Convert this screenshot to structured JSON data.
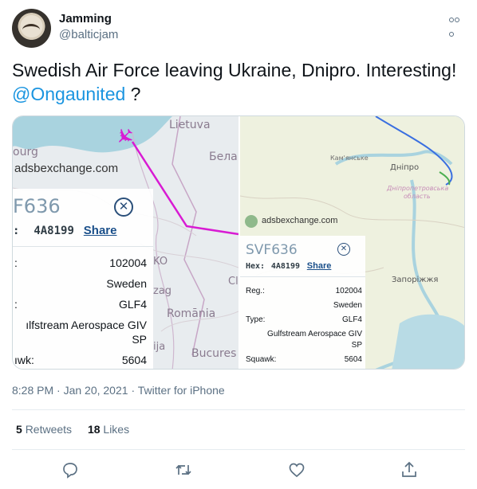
{
  "tweet": {
    "display_name": "Jamming",
    "handle": "@balticjam",
    "text_main": "Swedish Air Force leaving Ukraine, Dnipro. Interesting!",
    "mention": "@Ongaunited",
    "text_suffix": " ?",
    "timestamp": "8:28 PM · Jan 20, 2021",
    "client": "Twitter for iPhone",
    "retweets_count": "5",
    "retweets_label": "Retweets",
    "likes_count": "18",
    "likes_label": "Likes"
  },
  "media": {
    "left": {
      "map_labels": [
        "Lietuva",
        "Бела",
        "Romānia",
        "Bucures",
        "ourg",
        "zag",
        "ija",
        "KO",
        "Cl"
      ],
      "watermark": "adsbexchange.com",
      "callsign": "F636",
      "hex_label": ":",
      "hex_value": "4A8199",
      "share": "Share",
      "rows": [
        {
          "label": ":",
          "value": "102004"
        },
        {
          "label": "",
          "value": "Sweden"
        },
        {
          "label": ":",
          "value": "GLF4"
        },
        {
          "label": "",
          "value": "ılfstream Aerospace GIV"
        },
        {
          "label": "",
          "value": "SP"
        },
        {
          "label": "ıwk:",
          "value": "5604"
        }
      ]
    },
    "right": {
      "map_labels": [
        "Кам'янське",
        "Дніпро",
        "Дніпропетровська",
        "область",
        "Запоріжжя"
      ],
      "watermark": "adsbexchange.com",
      "callsign": "SVF636",
      "hex_label": "Hex:",
      "hex_value": "4A8199",
      "share": "Share",
      "rows": [
        {
          "label": "Reg.:",
          "value": "102004"
        },
        {
          "label": "",
          "value": "Sweden"
        },
        {
          "label": "Type:",
          "value": "GLF4"
        },
        {
          "label": "",
          "value": "Gulfstream Aerospace GIV"
        },
        {
          "label": "",
          "value": "SP"
        },
        {
          "label": "Squawk:",
          "value": "5604"
        }
      ]
    }
  },
  "icons": {
    "more": "more-icon",
    "reply": "reply-icon",
    "retweet": "retweet-icon",
    "like": "heart-icon",
    "share": "share-icon"
  },
  "colors": {
    "link": "#1b95e0",
    "muted": "#5b7083",
    "flight_path_left": "#d81bd3",
    "share_link": "#1a4f8a"
  }
}
